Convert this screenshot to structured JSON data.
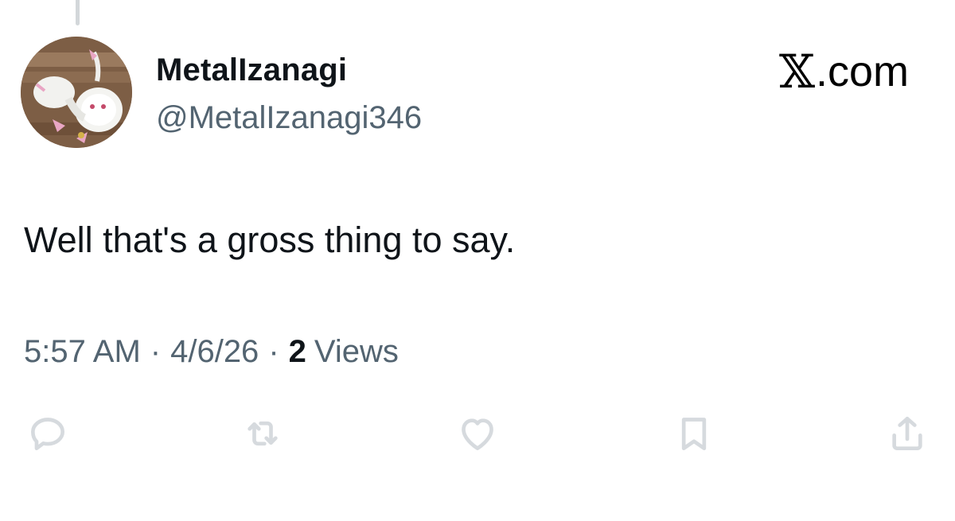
{
  "author": {
    "display_name": "MetalIzanagi",
    "handle": "@MetalIzanagi346"
  },
  "brand": {
    "x_glyph": "𝕏",
    "suffix": ".com"
  },
  "tweet": {
    "text": "Well that's a gross thing to say."
  },
  "meta": {
    "time": "5:57 AM",
    "separator": "·",
    "date": "4/6/26",
    "views_count": "2",
    "views_label": "Views"
  },
  "actions": [
    {
      "icon": "reply-icon"
    },
    {
      "icon": "retweet-icon"
    },
    {
      "icon": "heart-icon"
    },
    {
      "icon": "bookmark-icon"
    },
    {
      "icon": "share-icon"
    }
  ],
  "colors": {
    "primary_text": "#0f1419",
    "secondary_text": "#536471",
    "action_icons": "#d6dade",
    "thread_line": "#d3d7da"
  }
}
